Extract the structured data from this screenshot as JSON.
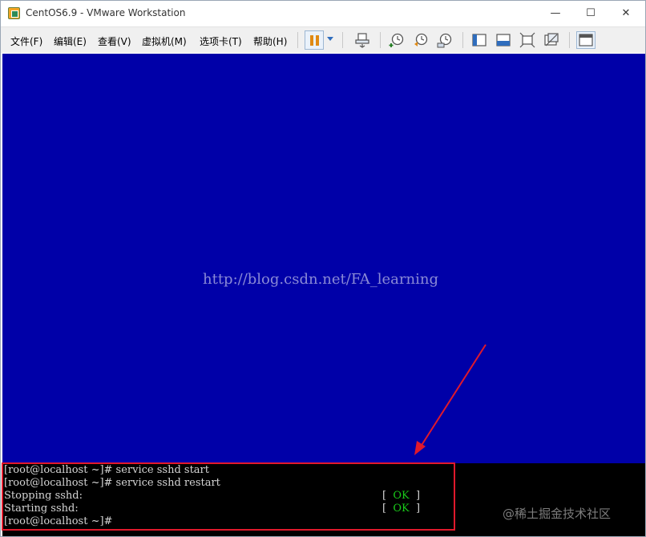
{
  "window": {
    "title": "CentOS6.9 - VMware Workstation",
    "controls": {
      "minimize": "—",
      "maximize": "☐",
      "close": "✕"
    }
  },
  "menu": {
    "items": [
      {
        "label": "文件(F)"
      },
      {
        "label": "编辑(E)"
      },
      {
        "label": "查看(V)"
      },
      {
        "label": "虚拟机(M)"
      },
      {
        "label": "选项卡(T)"
      },
      {
        "label": "帮助(H)"
      }
    ]
  },
  "toolbar": {
    "icons": [
      "pause-icon",
      "dropdown-arrow-icon",
      "send-ctrl-alt-del-icon",
      "snapshot-take-icon",
      "snapshot-revert-icon",
      "snapshot-manager-icon",
      "sidebar-toggle-icon",
      "thumbnail-bar-icon",
      "fullscreen-icon",
      "unity-icon",
      "console-view-icon"
    ]
  },
  "vm_screen": {
    "background_color": "#0000a8",
    "watermark_url": "http://blog.csdn.net/FA_learning"
  },
  "terminal": {
    "lines": [
      {
        "text": "[root@localhost ~]# service sshd start",
        "status": null
      },
      {
        "text": "[root@localhost ~]# service sshd restart",
        "status": null
      },
      {
        "text": "Stopping sshd:",
        "status": {
          "open": "[  ",
          "word": "OK",
          "close": "  ]"
        }
      },
      {
        "text": "Starting sshd:",
        "status": {
          "open": "[  ",
          "word": "OK",
          "close": "  ]"
        }
      },
      {
        "text": "[root@localhost ~]#",
        "status": null
      }
    ]
  },
  "annotation": {
    "highlight_color": "#e0192c",
    "corner_watermark": "@稀土掘金技术社区"
  }
}
